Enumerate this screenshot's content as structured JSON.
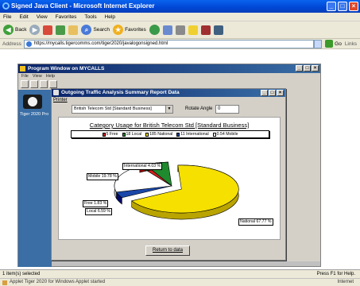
{
  "ie": {
    "title": "Signed Java Client - Microsoft Internet Explorer",
    "menu": [
      "File",
      "Edit",
      "View",
      "Favorites",
      "Tools",
      "Help"
    ],
    "toolbar": {
      "back": "Back",
      "search": "Search",
      "favorites": "Favorites"
    },
    "address_label": "Address",
    "address_url": "https://mycalls.tigercomms.com/tiger2020/javalogonsigned.html",
    "go": "Go",
    "links": "Links",
    "status_left": "1 item(s) selected",
    "status_right": "Press F1 for Help.",
    "applet_status": "Applet Tiger 2020 for Windows Applet started",
    "zone": "Internet"
  },
  "program_window": {
    "title": "Program Window on MYCALLS",
    "menu": [
      "File",
      "View",
      "Help"
    ],
    "left_label": "Tiger 2020 Pro"
  },
  "dialog": {
    "title": "Outgoing Traffic Analysis Summary Report Data",
    "menu_printer": "Printer",
    "company_select": "British Telecom Std [Standard Business]",
    "rotate_label": "Rotate Angle",
    "rotate_value": "0",
    "return_label": "Return to data"
  },
  "chart_data": {
    "type": "pie",
    "title": "Category Usage for British Telecom Std [Standard Business]",
    "legend": [
      "5 Free",
      "18 Local",
      "185 National",
      "11 International",
      "0.54 Mobile"
    ],
    "slices": [
      {
        "label": "National 67.77 %",
        "value": 67.77,
        "color": "#f5e000"
      },
      {
        "label": "International 4.03 %",
        "value": 4.03,
        "color": "#1a47a8"
      },
      {
        "label": "Mobile 19.78 %",
        "value": 19.78,
        "color": "#ffffff"
      },
      {
        "label": "Free 1.83 %",
        "value": 1.83,
        "color": "#d42020"
      },
      {
        "label": "Local 6.59 %",
        "value": 6.59,
        "color": "#1f8a2e"
      }
    ]
  },
  "colors": {
    "ie_title": "#0046d5",
    "mdi_title": "#0a246a",
    "mdi_bg": "#3a6ea5"
  }
}
